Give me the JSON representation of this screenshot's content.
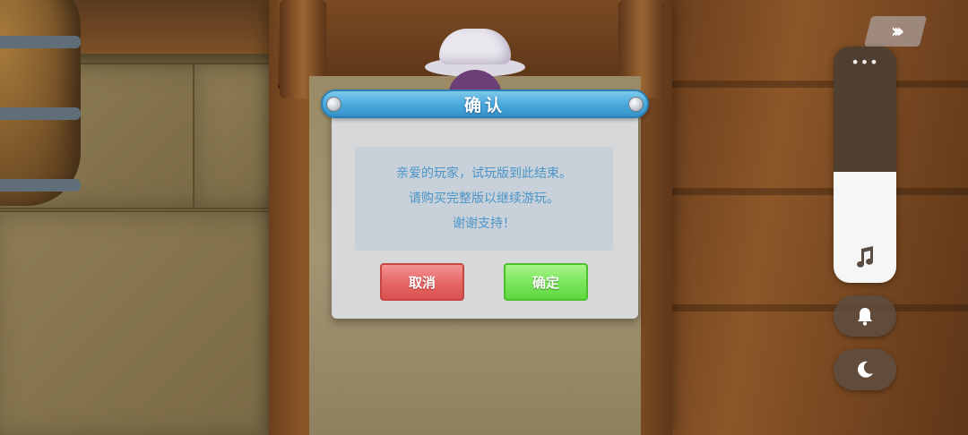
{
  "dialog": {
    "title": "确认",
    "message_lines": [
      "亲爱的玩家，试玩版到此结束。",
      "请购买完整版以继续游玩。",
      "谢谢支持！"
    ],
    "cancel_label": "取消",
    "confirm_label": "确定"
  },
  "overlay": {
    "skip_icon": "double-chevron-right-icon",
    "more_icon": "more-dots-icon",
    "volume_dots": "•••",
    "volume_level": 0.47,
    "music_icon": "music-note-icon",
    "bell_icon": "bell-icon",
    "moon_icon": "moon-icon"
  },
  "colors": {
    "header_blue": "#48a8dc",
    "message_text": "#4a95c6",
    "cancel_red": "#e46664",
    "confirm_green": "#79e55a"
  }
}
